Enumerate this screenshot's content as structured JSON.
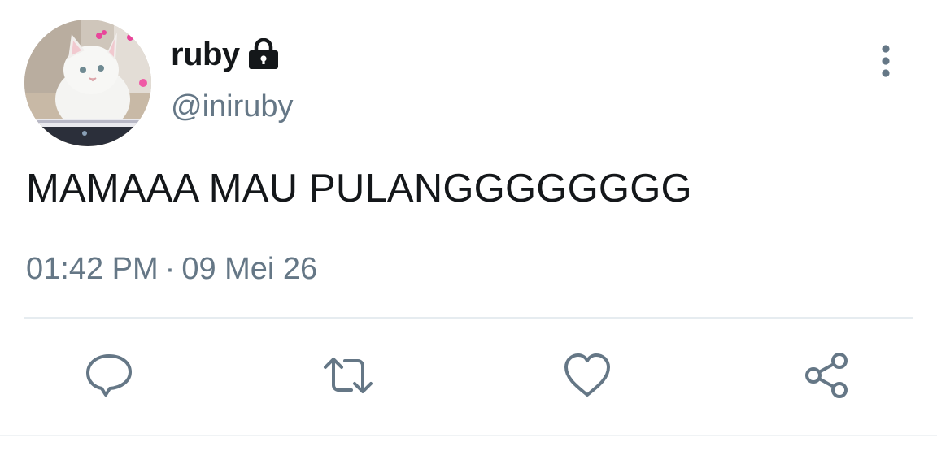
{
  "user": {
    "display_name": "ruby",
    "handle": "@iniruby",
    "protected_icon": "lock-icon",
    "avatar": "white-cat-avatar"
  },
  "tweet": {
    "text": "MAMAAA MAU PULANGGGGGGGG",
    "time": "01:42 PM",
    "separator": "·",
    "date": "09 Mei 26"
  },
  "actions": {
    "reply_icon": "reply-icon",
    "retweet_icon": "retweet-icon",
    "like_icon": "heart-icon",
    "share_icon": "share-icon",
    "more_icon": "more-vertical-icon"
  },
  "colors": {
    "text": "#14171a",
    "secondary": "#657786",
    "divider": "#e6ecf0"
  }
}
